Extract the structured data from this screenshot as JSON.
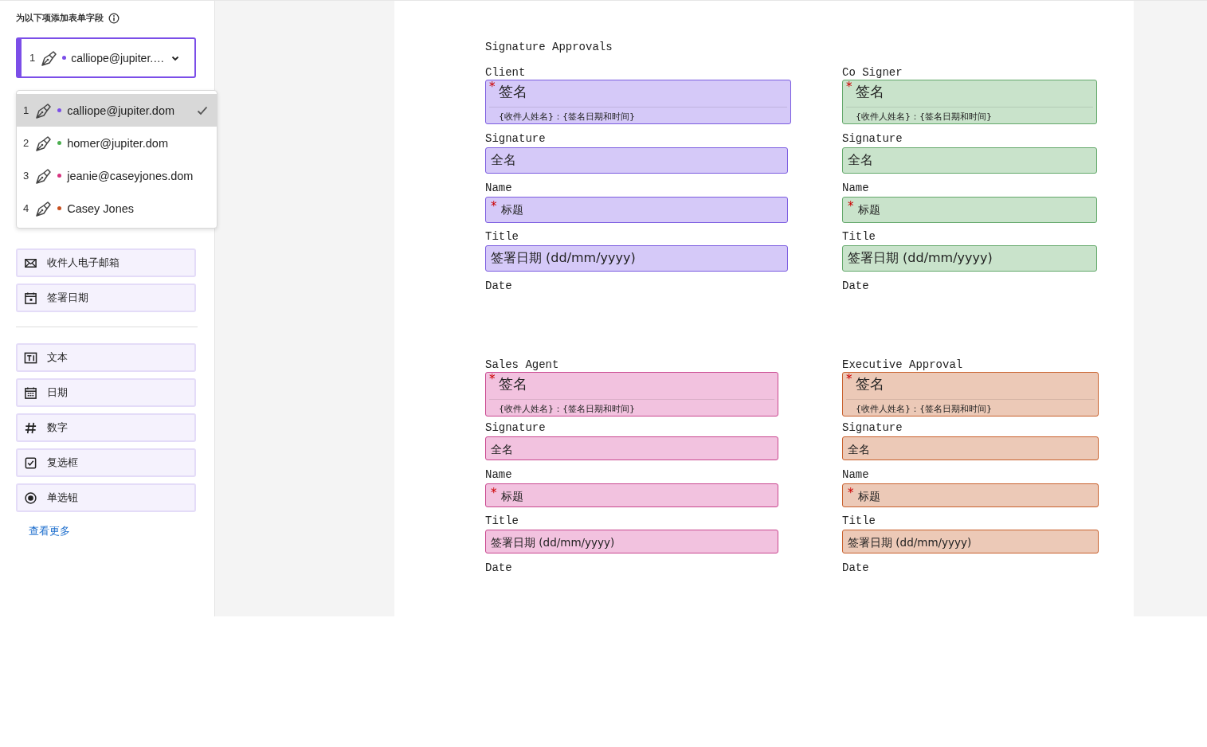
{
  "sidebar": {
    "heading": "为以下项添加表单字段",
    "selector": {
      "number": "1",
      "value": "calliope@jupiter.…",
      "color": "#7b4ee8"
    },
    "dropdown": [
      {
        "number": "1",
        "label": "calliope@jupiter.dom",
        "color": "#7b4ee8",
        "selected": true
      },
      {
        "number": "2",
        "label": "homer@jupiter.dom",
        "color": "#4caf50",
        "selected": false
      },
      {
        "number": "3",
        "label": "jeanie@caseyjones.dom",
        "color": "#d6337f",
        "selected": false
      },
      {
        "number": "4",
        "label": "Casey Jones",
        "color": "#c8501f",
        "selected": false
      }
    ],
    "recipient_fields": [
      {
        "kind": "email",
        "label": "收件人电子邮箱"
      },
      {
        "kind": "date-signed",
        "label": "签署日期"
      }
    ],
    "general_fields": [
      {
        "kind": "text",
        "label": "文本"
      },
      {
        "kind": "date",
        "label": "日期"
      },
      {
        "kind": "number",
        "label": "数字"
      },
      {
        "kind": "checkbox",
        "label": "复选框"
      },
      {
        "kind": "radio",
        "label": "单选钮"
      }
    ],
    "more_link": "查看更多"
  },
  "document": {
    "title": "Signature Approvals",
    "signers": [
      {
        "heading": "Client",
        "color": "#d5c9f8",
        "fields": [
          {
            "kind": "signature",
            "marker": "*",
            "text": "签名",
            "subtext": "{收件人姓名}：{签名日期和时间}",
            "caption": "Signature"
          },
          {
            "kind": "text",
            "text": "全名",
            "caption": "Name"
          },
          {
            "kind": "text",
            "marker": "*",
            "text": "标题",
            "caption": "Title"
          },
          {
            "kind": "text",
            "text": "签署日期 (dd/mm/yyyy)",
            "caption": "Date"
          }
        ]
      },
      {
        "heading": "Co Signer",
        "color": "#c9e3cb",
        "fields": [
          {
            "kind": "signature",
            "marker": "*",
            "text": "签名",
            "subtext": "{收件人姓名}：{签名日期和时间}",
            "caption": "Signature"
          },
          {
            "kind": "text",
            "text": "全名",
            "caption": "Name"
          },
          {
            "kind": "text",
            "marker": "*",
            "text": "标题",
            "caption": "Title"
          },
          {
            "kind": "text",
            "text": "签署日期 (dd/mm/yyyy)",
            "caption": "Date"
          }
        ]
      },
      {
        "heading": "Sales Agent",
        "color": "#f2c2df",
        "fields": [
          {
            "kind": "signature",
            "marker": "*",
            "text": "签名",
            "subtext": "{收件人姓名}：{签名日期和时间}",
            "caption": "Signature"
          },
          {
            "kind": "text",
            "text": "全名",
            "caption": "Name"
          },
          {
            "kind": "text",
            "marker": "*",
            "text": "标题",
            "caption": "Title"
          },
          {
            "kind": "text",
            "text": "签署日期 (dd/mm/yyyy)",
            "caption": "Date"
          }
        ]
      },
      {
        "heading": "Executive Approval",
        "color": "#ecc9b7",
        "fields": [
          {
            "kind": "signature",
            "marker": "*",
            "text": "签名",
            "subtext": "{收件人姓名}：{签名日期和时间}",
            "caption": "Signature"
          },
          {
            "kind": "text",
            "text": "全名",
            "caption": "Name"
          },
          {
            "kind": "text",
            "marker": "*",
            "text": "标题",
            "caption": "Title"
          },
          {
            "kind": "text",
            "text": "签署日期 (dd/mm/yyyy)",
            "caption": "Date"
          }
        ]
      }
    ]
  }
}
